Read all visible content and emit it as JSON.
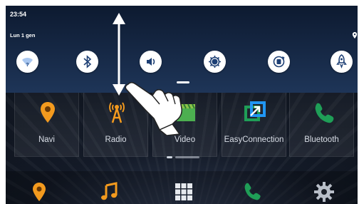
{
  "status": {
    "time": "23:54"
  },
  "shade": {
    "date": "Lun 1 gen",
    "quick_settings": [
      {
        "icon": "wifi-icon"
      },
      {
        "icon": "bluetooth-icon"
      },
      {
        "icon": "volume-icon"
      },
      {
        "icon": "brightness-icon"
      },
      {
        "icon": "rotate-icon"
      },
      {
        "icon": "rocket-icon"
      }
    ]
  },
  "apps": [
    {
      "label": "Navi",
      "icon": "location-pin-icon"
    },
    {
      "label": "Radio",
      "icon": "radio-tower-icon"
    },
    {
      "label": "Video",
      "icon": "clapperboard-icon"
    },
    {
      "label": "EasyConnection",
      "icon": "easyconnection-icon"
    },
    {
      "label": "Bluetooth",
      "icon": "phone-icon"
    }
  ],
  "dock": [
    {
      "icon": "location-pin-icon"
    },
    {
      "icon": "music-note-icon"
    },
    {
      "icon": "app-grid-icon"
    },
    {
      "icon": "phone-icon"
    },
    {
      "icon": "settings-gear-icon"
    }
  ],
  "colors": {
    "accent_orange": "#f39a1e",
    "accent_green": "#1f9e57",
    "shade_top": "#0d1a30",
    "shade_bottom": "#1e3558"
  }
}
